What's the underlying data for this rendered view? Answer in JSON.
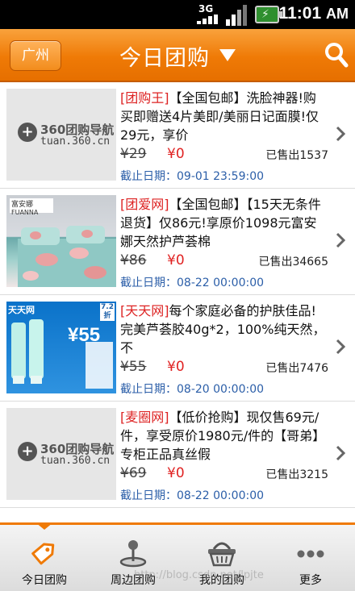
{
  "status_bar": {
    "network": "3G",
    "time": "11:01",
    "ampm": "AM"
  },
  "header": {
    "city": "广州",
    "title": "今日团购"
  },
  "deals": [
    {
      "thumb": {
        "type": "logo",
        "logo_text": "360团购导航",
        "logo_url": "tuan.360.cn"
      },
      "site": "[团购王]",
      "description": "【全国包邮】洗脸神器!购买即赠送4片美即/美丽日记面膜!仅29元，享价",
      "original_price": "¥29",
      "current_price": "¥0",
      "sold": "已售出1537",
      "deadline": "截止日期：09-01 23:59:00"
    },
    {
      "thumb": {
        "type": "bedding",
        "brand": "富安娜",
        "brand_en": "FUANNA"
      },
      "site": "[团爱网]",
      "description": "【全国包邮】【15天无条件退货】仅86元!享原价1098元富安娜天然护芦荟棉",
      "original_price": "¥86",
      "current_price": "¥0",
      "sold": "已售出34665",
      "deadline": "截止日期：08-22 00:00:00"
    },
    {
      "thumb": {
        "type": "skincare",
        "brand": "天天网",
        "badge": "7.2折",
        "price": "¥55"
      },
      "site": "[天天网]",
      "description": "每个家庭必备的护肤佳品!完美芦荟胶40g*2，100%纯天然，不",
      "original_price": "¥55",
      "current_price": "¥0",
      "sold": "已售出7476",
      "deadline": "截止日期：08-20 00:00:00"
    },
    {
      "thumb": {
        "type": "logo",
        "logo_text": "360团购导航",
        "logo_url": "tuan.360.cn"
      },
      "site": "[麦圈网]",
      "description": "【低价抢购】现仅售69元/件，享受原价1980元/件的【哥弟】专柜正品真丝假",
      "original_price": "¥69",
      "current_price": "¥0",
      "sold": "已售出3215",
      "deadline": "截止日期：08-22 00:00:00"
    }
  ],
  "bottom_nav": [
    {
      "label": "今日团购",
      "icon": "tag-icon",
      "active": true
    },
    {
      "label": "周边团购",
      "icon": "map-pin-icon",
      "active": false
    },
    {
      "label": "我的团购",
      "icon": "basket-icon",
      "active": false
    },
    {
      "label": "更多",
      "icon": "more-icon",
      "active": false
    }
  ],
  "watermark": "http://blog.csdn.net/lpjte",
  "colors": {
    "header": "#ef7a06",
    "site": "#dd2222",
    "price": "#e02222",
    "deadline": "#2b5ea8"
  }
}
